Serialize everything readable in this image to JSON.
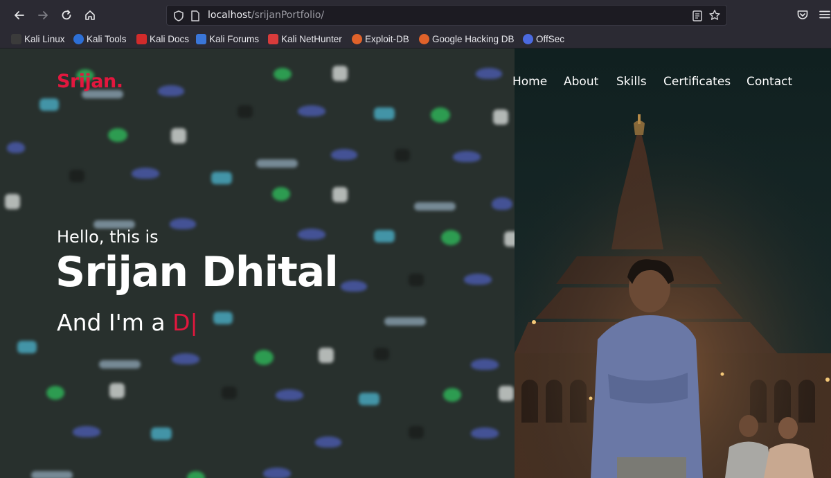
{
  "browser": {
    "url_host": "localhost",
    "url_path": "/srijanPortfolio/",
    "bookmarks": [
      {
        "label": "Kali Linux",
        "color": "#3b3b3b"
      },
      {
        "label": "Kali Tools",
        "color": "#2d6fd6"
      },
      {
        "label": "Kali Docs",
        "color": "#d12b2b"
      },
      {
        "label": "Kali Forums",
        "color": "#3a76d8"
      },
      {
        "label": "Kali NetHunter",
        "color": "#d93b3b"
      },
      {
        "label": "Exploit-DB",
        "color": "#e0622a"
      },
      {
        "label": "Google Hacking DB",
        "color": "#e0622a"
      },
      {
        "label": "OffSec",
        "color": "#4b6ae0"
      }
    ]
  },
  "site": {
    "logo": "Srijan.",
    "nav": [
      "Home",
      "About",
      "Skills",
      "Certificates",
      "Contact"
    ],
    "hero": {
      "greeting": "Hello, this is",
      "name": "Srijan Dhital",
      "role_prefix": "And I'm a ",
      "role_typed": "D",
      "cursor": "|"
    },
    "accent_color": "#e3173e"
  }
}
